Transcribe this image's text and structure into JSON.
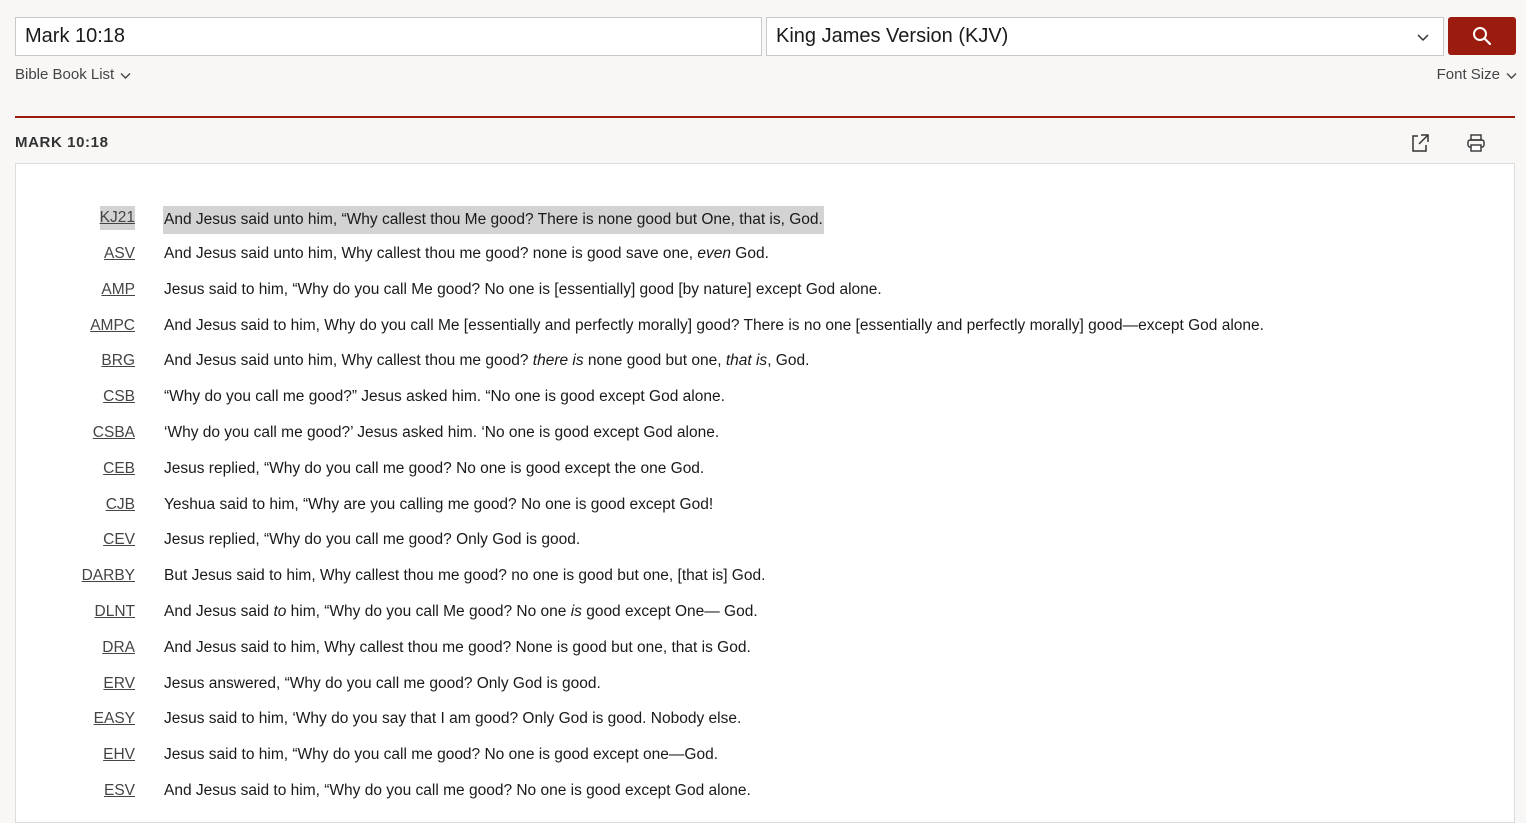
{
  "search": {
    "reference_value": "Mark 10:18",
    "version_selected": "King James Version (KJV)"
  },
  "nav": {
    "book_list_label": "Bible Book List",
    "font_size_label": "Font Size"
  },
  "passage": {
    "title": "MARK 10:18"
  },
  "verses": [
    {
      "abbr": "KJ21",
      "parts": [
        "And Jesus said unto him, “Why callest thou Me good? There is none good but One, that is, God."
      ]
    },
    {
      "abbr": "ASV",
      "parts": [
        "And Jesus said unto him, Why callest thou me good? none is good save one, ",
        "even",
        " God."
      ]
    },
    {
      "abbr": "AMP",
      "parts": [
        "Jesus said to him, “Why do you call Me good? No one is [essentially] good [by nature] except God alone."
      ]
    },
    {
      "abbr": "AMPC",
      "parts": [
        "And Jesus said to him, Why do you call Me [essentially and perfectly morally] good? There is no one [essentially and perfectly morally] good—except God alone."
      ]
    },
    {
      "abbr": "BRG",
      "parts": [
        "And Jesus said unto him, Why callest thou me good? ",
        "there is",
        " none good but one, ",
        "that is",
        ", God."
      ]
    },
    {
      "abbr": "CSB",
      "parts": [
        "“Why do you call me good?” Jesus asked him. “No one is good except God alone."
      ]
    },
    {
      "abbr": "CSBA",
      "parts": [
        "‘Why do you call me good?’ Jesus asked him. ‘No one is good except God alone."
      ]
    },
    {
      "abbr": "CEB",
      "parts": [
        "Jesus replied, “Why do you call me good? No one is good except the one God."
      ]
    },
    {
      "abbr": "CJB",
      "parts": [
        "Yeshua said to him, “Why are you calling me good? No one is good except God!"
      ]
    },
    {
      "abbr": "CEV",
      "parts": [
        "Jesus replied, “Why do you call me good? Only God is good."
      ]
    },
    {
      "abbr": "DARBY",
      "parts": [
        "But Jesus said to him, Why callest thou me good? no one is good but one, [that is] God."
      ]
    },
    {
      "abbr": "DLNT",
      "parts": [
        "And Jesus said ",
        "to",
        " him, “Why do you call Me good? No one ",
        "is",
        " good except One— God."
      ]
    },
    {
      "abbr": "DRA",
      "parts": [
        "And Jesus said to him, Why callest thou me good? None is good but one, that is God."
      ]
    },
    {
      "abbr": "ERV",
      "parts": [
        "Jesus answered, “Why do you call me good? Only God is good."
      ]
    },
    {
      "abbr": "EASY",
      "parts": [
        "Jesus said to him, ‘Why do you say that I am good? Only God is good. Nobody else."
      ]
    },
    {
      "abbr": "EHV",
      "parts": [
        "Jesus said to him, “Why do you call me good? No one is good except one—God."
      ]
    },
    {
      "abbr": "ESV",
      "parts": [
        "And Jesus said to him, “Why do you call me good? No one is good except God alone."
      ]
    }
  ],
  "icons": {
    "search": "search-icon",
    "share": "share-icon",
    "print": "print-icon",
    "chevron": "chevron-down-icon"
  },
  "colors": {
    "accent": "#9b1c0f",
    "highlight": "#d3d3d3"
  }
}
